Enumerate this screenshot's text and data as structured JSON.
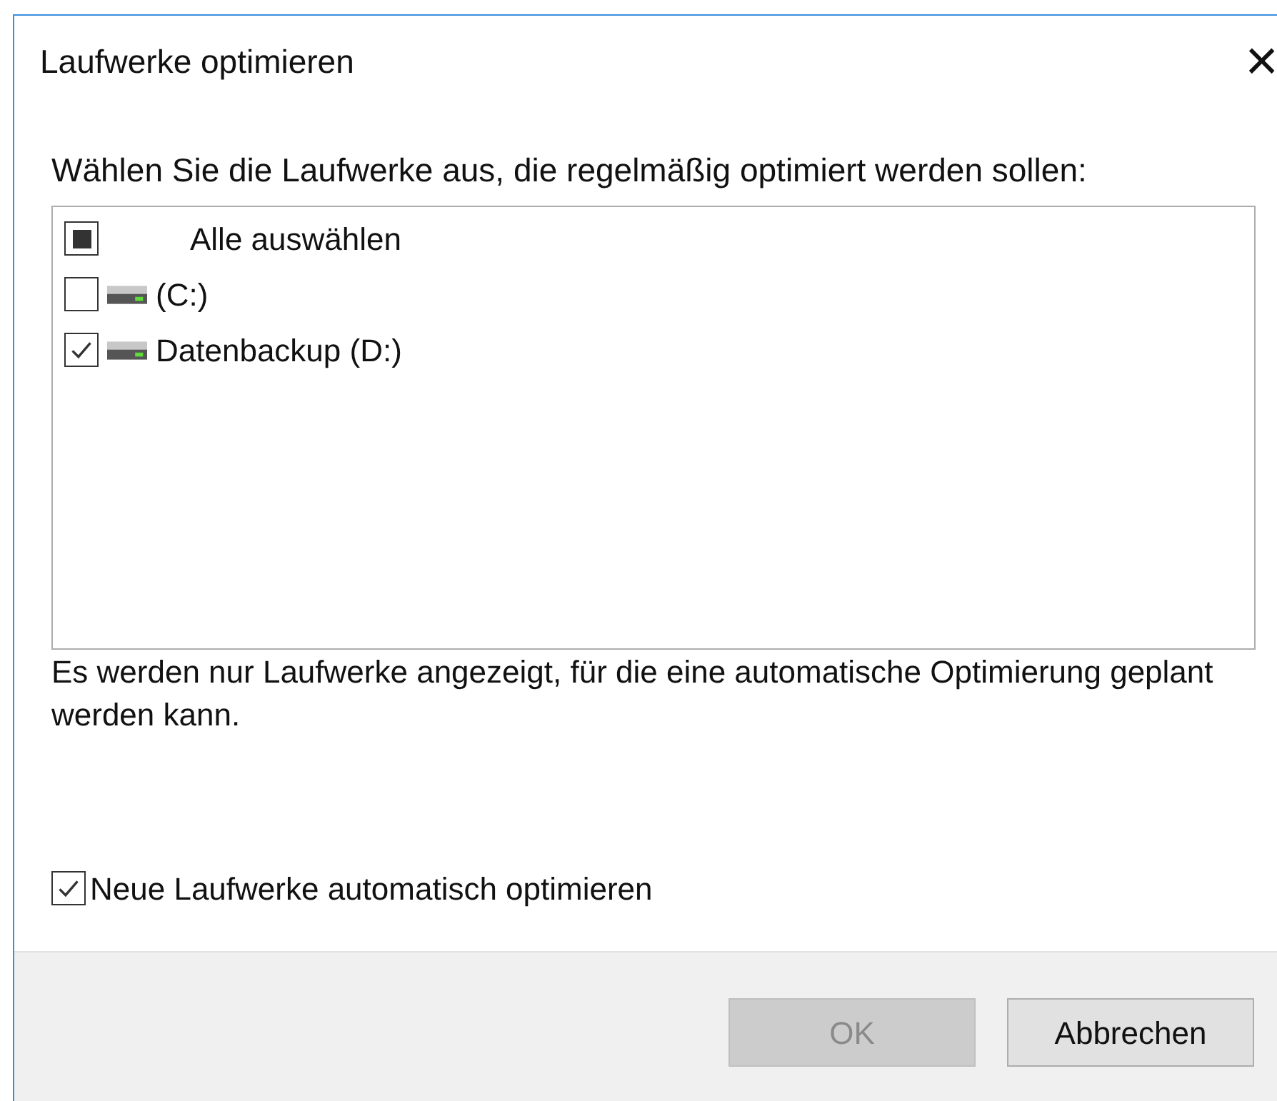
{
  "window": {
    "title": "Laufwerke optimieren",
    "close": "×"
  },
  "instruction": "Wählen Sie die Laufwerke aus, die regelmäßig optimiert werden sollen:",
  "drives": [
    {
      "kind": "select-all",
      "label": "Alle auswählen",
      "checked": false,
      "indeterminate": true
    },
    {
      "kind": "drive",
      "label": "(C:)",
      "checked": false
    },
    {
      "kind": "drive",
      "label": "Datenbackup (D:)",
      "checked": true
    }
  ],
  "note": "Es werden nur Laufwerke angezeigt, für die eine automatische Optimierung geplant werden kann.",
  "auto_option": {
    "label": "Neue Laufwerke automatisch optimieren",
    "checked": true
  },
  "buttons": [
    {
      "label": "OK",
      "disabled": true
    },
    {
      "label": "Abbrechen",
      "disabled": false
    }
  ]
}
